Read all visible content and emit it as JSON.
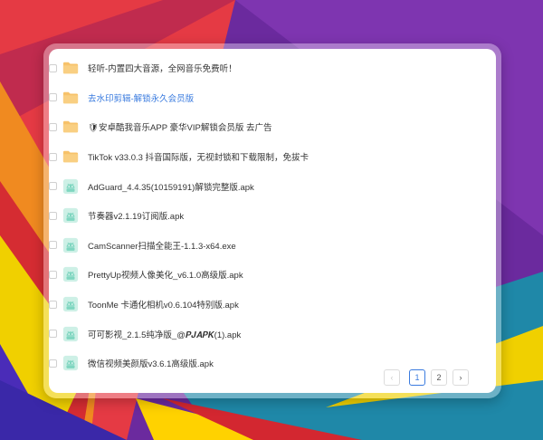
{
  "files": [
    {
      "name": "轻听-内置四大音源，全网音乐免费听！",
      "type": "folder",
      "link": false
    },
    {
      "name": "去水印剪辑-解锁永久会员版",
      "type": "folder",
      "link": true
    },
    {
      "name": "🛡安卓酷我音乐APP 豪华VIP解锁会员版 去广告",
      "type": "folder",
      "link": false
    },
    {
      "name": "TikTok v33.0.3 抖音国际版，无视封锁和下载限制，免拔卡",
      "type": "folder",
      "link": false
    },
    {
      "name": "AdGuard_4.4.35(10159191)解锁完整版.apk",
      "type": "apk",
      "link": false
    },
    {
      "name": "节奏器v2.1.19订阅版.apk",
      "type": "apk",
      "link": false
    },
    {
      "name": "CamScanner扫描全能王-1.1.3-x64.exe",
      "type": "apk",
      "link": false
    },
    {
      "name": "PrettyUp视频人像美化_v6.1.0高级版.apk",
      "type": "apk",
      "link": false
    },
    {
      "name": "ToonMe 卡通化相机v0.6.104特别版.apk",
      "type": "apk",
      "link": false
    },
    {
      "name": "可可影视_2.1.5纯净版_@𝑷𝑱𝑨𝑷𝑲(1).apk",
      "type": "apk",
      "link": false
    },
    {
      "name": "微信视频美颜版v3.6.1高级版.apk",
      "type": "apk",
      "link": false
    }
  ],
  "pagination": {
    "prev": "‹",
    "pages": [
      "1",
      "2"
    ],
    "current": "1",
    "next": "›"
  },
  "colors": {
    "folder": "#f7c26a",
    "apk": "#7fd6c0",
    "link": "#3a7bdf",
    "active_page": "#3a7bdf"
  }
}
